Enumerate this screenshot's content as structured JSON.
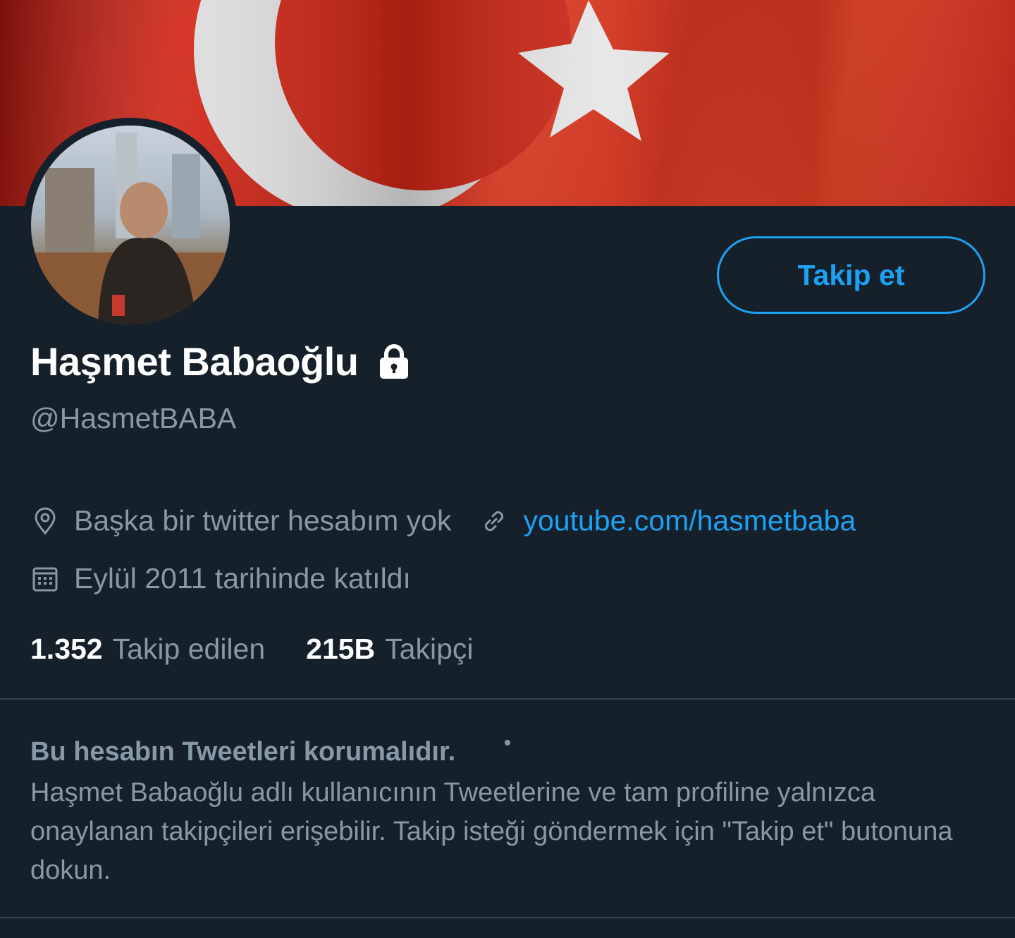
{
  "banner": {
    "alt": "turkish-flag-banner"
  },
  "profile": {
    "name": "Haşmet Babaoğlu",
    "handle": "@HasmetBABA",
    "follow_label": "Takip et",
    "location": "Başka bir twitter hesabım yok",
    "website": "youtube.com/hasmetbaba",
    "joined": "Eylül 2011 tarihinde katıldı",
    "following_count": "1.352",
    "following_label": "Takip edilen",
    "followers_count": "215B",
    "followers_label": "Takipçi"
  },
  "protected_notice": {
    "title": "Bu hesabın Tweetleri korumalıdır.",
    "body": "Haşmet Babaoğlu adlı kullanıcının Tweetlerine ve tam profiline yalnızca onaylanan takipçileri erişebilir. Takip isteği göndermek için \"Takip et\" butonuna dokun."
  },
  "colors": {
    "background": "#15202b",
    "accent": "#1da1f2",
    "secondary_text": "#8899a6",
    "divider": "#38444d"
  },
  "icons": [
    "lock-icon",
    "location-icon",
    "link-icon",
    "calendar-icon"
  ]
}
